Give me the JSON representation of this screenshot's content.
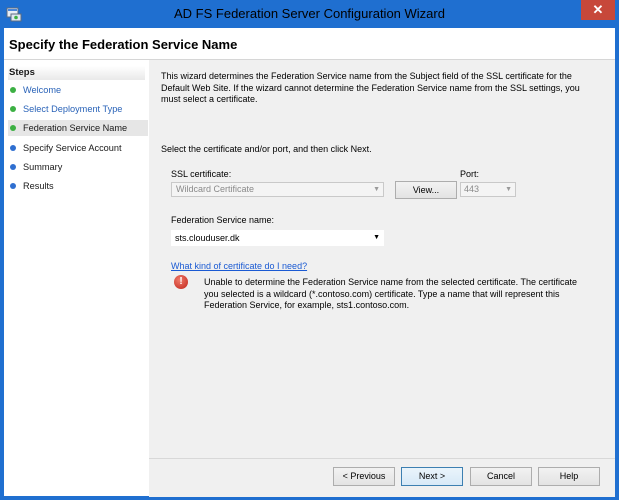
{
  "window": {
    "title": "AD FS Federation Server Configuration Wizard",
    "close_glyph": "✕",
    "icon": "wizard-app-icon"
  },
  "header": {
    "title": "Specify the Federation Service Name"
  },
  "sidebar": {
    "heading": "Steps",
    "steps": [
      {
        "label": "Welcome",
        "state": "done"
      },
      {
        "label": "Select Deployment Type",
        "state": "done"
      },
      {
        "label": "Federation Service Name",
        "state": "current"
      },
      {
        "label": "Specify Service Account",
        "state": "todo"
      },
      {
        "label": "Summary",
        "state": "todo"
      },
      {
        "label": "Results",
        "state": "todo"
      }
    ],
    "dot_colors": {
      "done": "#3cb043",
      "current": "#3cb043",
      "todo": "#2f6fd0"
    }
  },
  "main": {
    "intro": "This wizard determines the Federation Service name from the Subject field of the SSL certificate for the Default Web Site.  If the wizard cannot determine the Federation Service name from the SSL settings, you must select a certificate.",
    "instruction": "Select the certificate and/or port, and then click Next.",
    "ssl_label": "SSL certificate:",
    "ssl_value": "Wildcard Certificate",
    "view_button": "View...",
    "port_label": "Port:",
    "port_value": "443",
    "fsn_label": "Federation Service name:",
    "fsn_value": "sts.clouduser.dk",
    "help_link": "What kind of certificate do I need?",
    "error_glyph": "!",
    "error_text": "Unable to determine the Federation Service name from the selected certificate. The certificate you selected is a wildcard (*.contoso.com) certificate. Type a name that will represent this Federation Service, for example, sts1.contoso.com."
  },
  "footer": {
    "previous": "< Previous",
    "next": "Next >",
    "cancel": "Cancel",
    "help": "Help"
  },
  "colors": {
    "titlebar": "#1f6fd0",
    "close": "#c7483a",
    "link": "#1a5ad3",
    "error": "#c0241a"
  }
}
